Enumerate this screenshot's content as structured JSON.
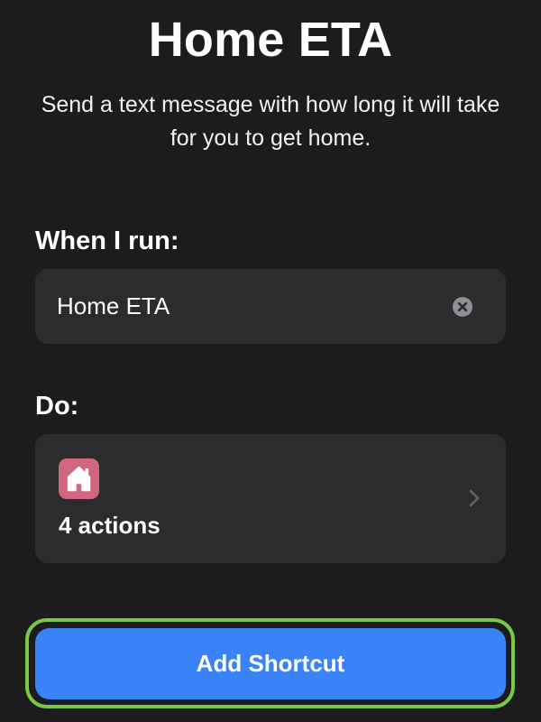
{
  "header": {
    "title": "Home ETA",
    "description": "Send a text message with how long it will take for you to get home."
  },
  "when_section": {
    "label": "When I run:",
    "shortcut_name_value": "Home ETA",
    "clear_icon": "xmark-circle-fill-icon"
  },
  "do_section": {
    "label": "Do:",
    "app_icon": "house-icon",
    "app_icon_color": "#d0677f",
    "actions_label": "4 actions",
    "disclosure_icon": "chevron-right-icon"
  },
  "footer": {
    "add_button_label": "Add Shortcut",
    "button_color": "#3a82f7",
    "focus_ring_color": "#7ac943"
  }
}
